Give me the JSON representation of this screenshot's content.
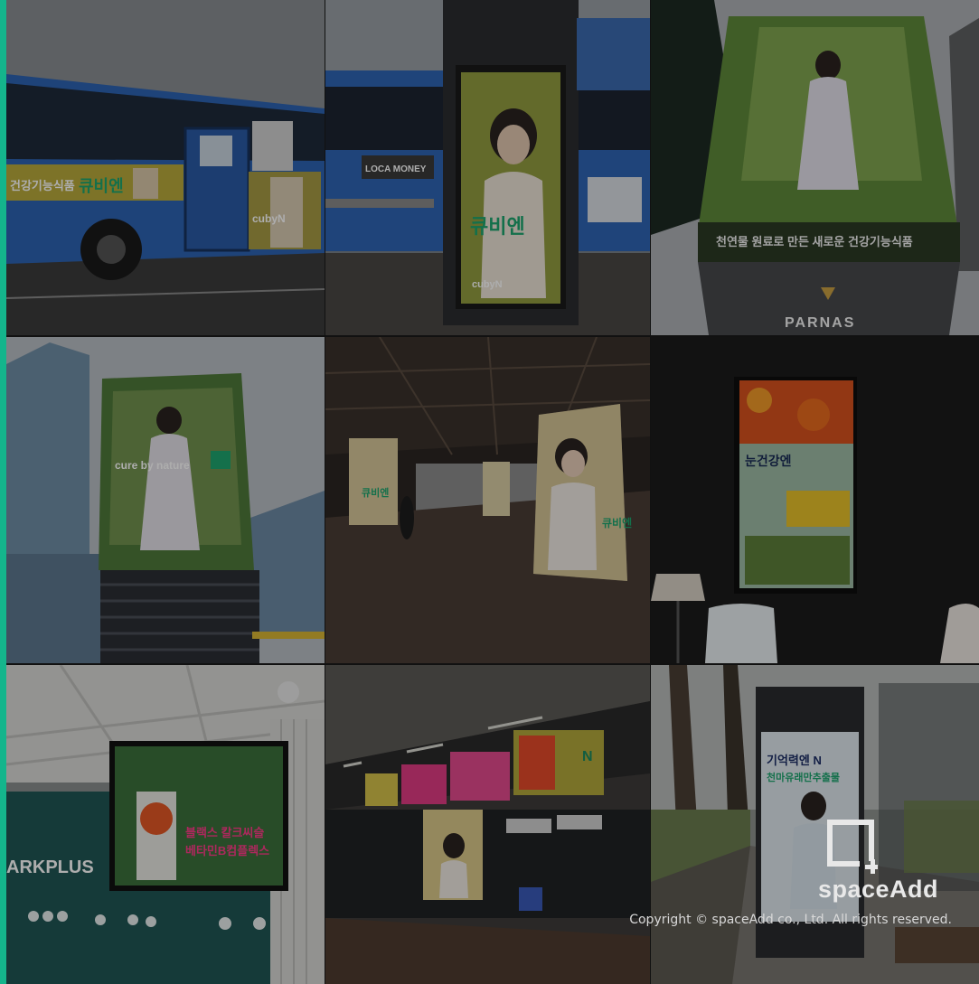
{
  "brand": {
    "logo_name": "spaceAdd",
    "copyright": "Copyright © spaceAdd co., Ltd. All rights reserved.",
    "accent_color": "#14b58c"
  },
  "photos": {
    "bus": {
      "ad_text": "큐비엔",
      "ad_brand": "cubyN",
      "ad_left_text": "건강기능식품"
    },
    "bus_stop": {
      "bus_panel": "LOCA MONEY",
      "poster_title": "큐비엔",
      "poster_brand": "cubyN"
    },
    "parnas": {
      "screen_caption": "천연물 원료로 만든 새로운 건강기능식품",
      "building_name": "PARNAS"
    },
    "tower_screen": {
      "slogan": "cure by nature"
    },
    "station_pillars": {
      "pillar_text": "큐비엔"
    },
    "lobby_display": {
      "title": "눈건강엔"
    },
    "store_screen": {
      "store_name": "ARKPLUS",
      "ad_line1": "블랙스 칼크씨슬",
      "ad_line2": "베타민B컴플렉스"
    },
    "subway_platform": {
      "ad_text": "N"
    },
    "outdoor_kiosk": {
      "poster_line1": "기억력엔 N",
      "poster_line2": "천마유래만추출물"
    }
  }
}
